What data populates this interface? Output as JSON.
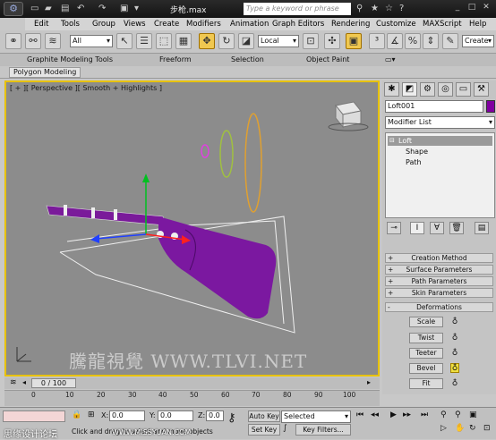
{
  "titlebar": {
    "document": "步枪.max",
    "search_placeholder": "Type a keyword or phrase"
  },
  "menu": [
    "Edit",
    "Tools",
    "Group",
    "Views",
    "Create",
    "Modifiers",
    "Animation",
    "Graph Editors",
    "Rendering",
    "Customize",
    "MAXScript",
    "Help"
  ],
  "toolbar": {
    "selection_filter": "All",
    "ref_coord": "Local",
    "named_selection": "Create"
  },
  "ribbon": {
    "tabs": [
      "Graphite Modeling Tools",
      "Freeform",
      "Selection",
      "Object Paint"
    ],
    "panel": "Polygon Modeling"
  },
  "viewport": {
    "label": "[ + ][ Perspective ][ Smooth + Highlights ]",
    "watermark": "騰龍視覺 WWW.TLVI.NET"
  },
  "command_panel": {
    "object_name": "Loft001",
    "object_color": "#8000a0",
    "modifier_list": "Modifier List",
    "stack": [
      {
        "label": "Loft",
        "selected": true
      },
      {
        "label": "Shape",
        "selected": false
      },
      {
        "label": "Path",
        "selected": false
      }
    ],
    "rollouts": [
      {
        "sign": "+",
        "label": "Creation Method"
      },
      {
        "sign": "+",
        "label": "Surface Parameters"
      },
      {
        "sign": "+",
        "label": "Path Parameters"
      },
      {
        "sign": "+",
        "label": "Skin Parameters"
      },
      {
        "sign": "-",
        "label": "Deformations"
      }
    ],
    "deformations": [
      "Scale",
      "Twist",
      "Teeter",
      "Bevel",
      "Fit"
    ]
  },
  "timeline": {
    "frame": "0 / 100",
    "ticks": [
      "0",
      "10",
      "20",
      "30",
      "40",
      "50",
      "60",
      "70",
      "80",
      "90",
      "100"
    ]
  },
  "status": {
    "x_label": "X:",
    "x_value": "0.0",
    "y_label": "Y:",
    "y_value": "0.0",
    "z_label": "Z:",
    "z_value": "0.0",
    "autokey": "Auto Key",
    "setkey": "Set Key",
    "selected": "Selected",
    "keyfilters": "Key Filters...",
    "prompt": "Click and drag to select and move objects"
  },
  "footer": {
    "left": "思缘设计论坛",
    "right": "WWW.MISSYUAN.COM"
  }
}
